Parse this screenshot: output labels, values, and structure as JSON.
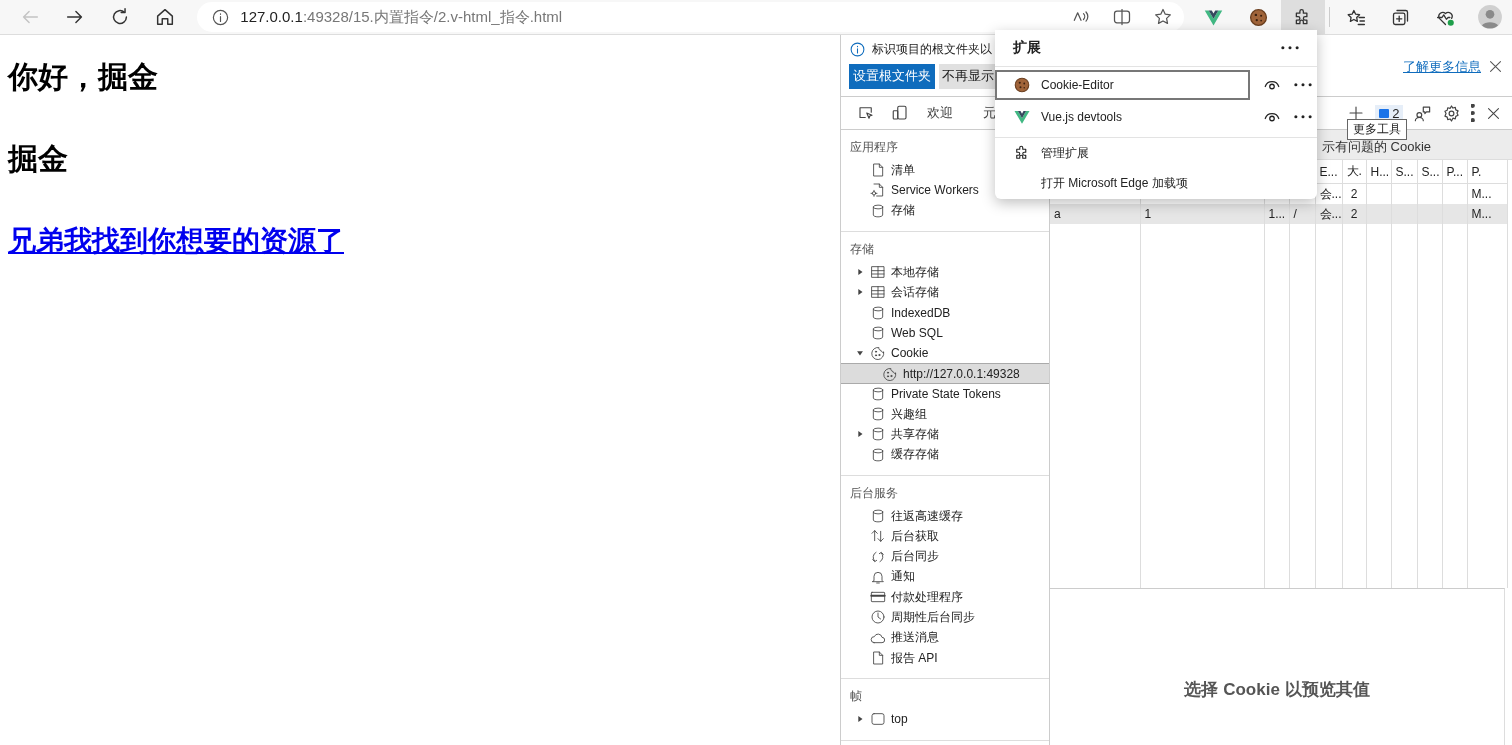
{
  "browser": {
    "nav": [
      {
        "kind": "back",
        "disabled": true
      },
      {
        "kind": "forward",
        "disabled": false
      },
      {
        "kind": "refresh",
        "disabled": false
      },
      {
        "kind": "home",
        "disabled": false
      }
    ],
    "address": {
      "host": "127.0.0.1",
      "path": ":49328/15.内置指令/2.v-html_指令.html"
    },
    "address_actions": [
      {
        "kind": "read-aloud"
      },
      {
        "kind": "split"
      },
      {
        "kind": "star"
      }
    ],
    "toolbar": [
      {
        "kind": "vue",
        "selected": false
      },
      {
        "kind": "cookie",
        "selected": false
      },
      {
        "kind": "extensions",
        "selected": true
      },
      {
        "kind": "favorites",
        "selected": false
      },
      {
        "kind": "collections",
        "selected": false
      },
      {
        "kind": "health",
        "selected": false
      },
      {
        "kind": "profile",
        "selected": false
      }
    ]
  },
  "page": {
    "blocks": [
      {
        "kind": "heading",
        "text": "你好，掘金"
      },
      {
        "kind": "heading",
        "text": "掘金"
      },
      {
        "kind": "link",
        "text": "兄弟我找到你想要的资源了"
      }
    ]
  },
  "devtools": {
    "infobar": {
      "message": "标识项目的根文件夹以",
      "buttons": [
        {
          "label": "设置根文件夹",
          "kind": "primary"
        },
        {
          "label": "不再显示",
          "kind": "secondary"
        }
      ],
      "link": "了解更多信息"
    },
    "tabs": [
      {
        "label": "欢迎",
        "selected": false
      },
      {
        "label": "元",
        "selected": false
      }
    ],
    "issues_count": "2",
    "tooltip": "更多工具",
    "sidebar": [
      {
        "title": "应用程序",
        "items": [
          {
            "kind": "file",
            "label": "清单",
            "selected": false
          },
          {
            "kind": "worker",
            "label": "Service Workers",
            "selected": false
          },
          {
            "kind": "db",
            "label": "存储",
            "selected": false
          }
        ]
      },
      {
        "title": "存储",
        "items": [
          {
            "kind": "table",
            "label": "本地存储",
            "selected": false,
            "expanded": false
          },
          {
            "kind": "table",
            "label": "会话存储",
            "selected": false,
            "expanded": false
          },
          {
            "kind": "db",
            "label": "IndexedDB",
            "selected": false
          },
          {
            "kind": "db",
            "label": "Web SQL",
            "selected": false
          },
          {
            "kind": "cookie",
            "label": "Cookie",
            "selected": false,
            "expanded": true,
            "children": [
              {
                "kind": "cookie",
                "label": "http://127.0.0.1:49328",
                "selected": true
              }
            ]
          },
          {
            "kind": "db",
            "label": "Private State Tokens",
            "selected": false
          },
          {
            "kind": "db",
            "label": "兴趣组",
            "selected": false
          },
          {
            "kind": "db",
            "label": "共享存储",
            "selected": false,
            "expanded": false
          },
          {
            "kind": "db",
            "label": "缓存存储",
            "selected": false
          }
        ]
      },
      {
        "title": "后台服务",
        "items": [
          {
            "kind": "db",
            "label": "往返高速缓存",
            "selected": false
          },
          {
            "kind": "fetch",
            "label": "后台获取",
            "selected": false
          },
          {
            "kind": "sync",
            "label": "后台同步",
            "selected": false
          },
          {
            "kind": "bell",
            "label": "通知",
            "selected": false
          },
          {
            "kind": "card",
            "label": "付款处理程序",
            "selected": false
          },
          {
            "kind": "clock",
            "label": "周期性后台同步",
            "selected": false
          },
          {
            "kind": "cloud",
            "label": "推送消息",
            "selected": false
          },
          {
            "kind": "file",
            "label": "报告 API",
            "selected": false
          }
        ]
      },
      {
        "title": "帧",
        "items": [
          {
            "kind": "frame",
            "label": "top",
            "selected": false,
            "expanded": false
          }
        ]
      }
    ],
    "filter_label": "示有问题的 Cookie",
    "table": {
      "columns": [
        null,
        null,
        null,
        null,
        "E...",
        "大.",
        "H...",
        "S...",
        "S...",
        "P...",
        "P."
      ],
      "rows": [
        {
          "selected": false,
          "cells": [
            null,
            null,
            null,
            null,
            "会...",
            "2",
            null,
            null,
            null,
            null,
            "M..."
          ]
        },
        {
          "selected": true,
          "cells": [
            "a",
            "1",
            "1...",
            "/",
            "会...",
            "2",
            null,
            null,
            null,
            null,
            "M..."
          ]
        }
      ]
    },
    "preview_hint": "选择 Cookie 以预览其值"
  },
  "extensions_menu": {
    "title": "扩展",
    "extensions": [
      {
        "kind": "cookie",
        "label": "Cookie-Editor",
        "focused": true
      },
      {
        "kind": "vue",
        "label": "Vue.js devtools",
        "focused": false
      }
    ],
    "actions": [
      {
        "kind": "manage",
        "label": "管理扩展"
      },
      {
        "kind": "addons",
        "label": "打开 Microsoft Edge 加载项"
      }
    ]
  }
}
